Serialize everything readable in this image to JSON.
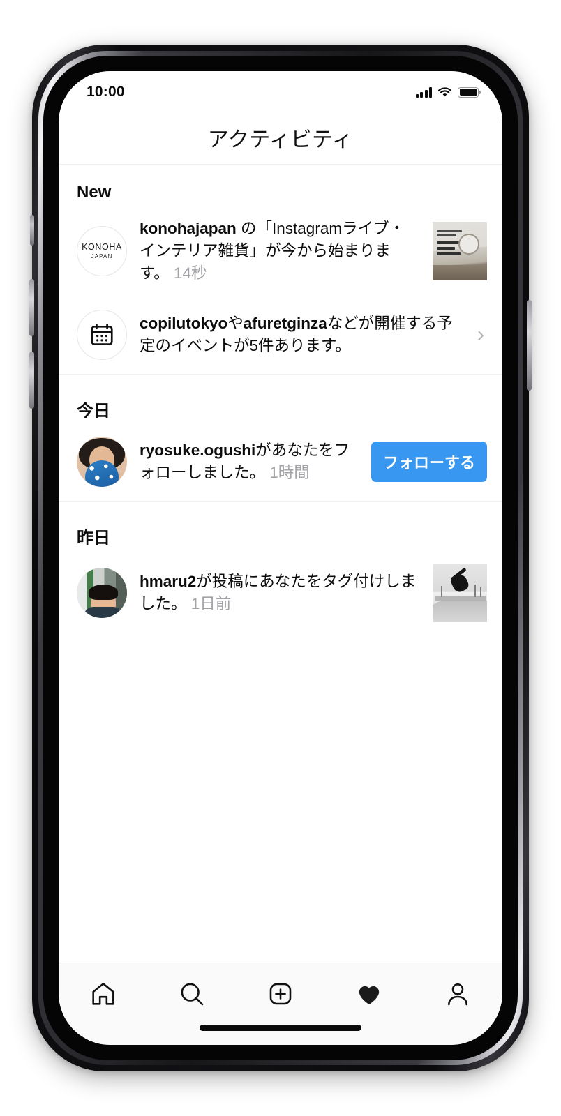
{
  "status_bar": {
    "time": "10:00",
    "signal_icon": "cellular-bars-icon",
    "wifi_icon": "wifi-icon",
    "battery_icon": "battery-full-icon"
  },
  "header": {
    "title": "アクティビティ"
  },
  "sections": [
    {
      "id": "new",
      "title": "New",
      "items": [
        {
          "id": "konohajapan-live",
          "avatar_type": "konoha-logo",
          "avatar_line1": "KONOHA",
          "avatar_line2": "JAPAN",
          "username": "konohajapan",
          "text": " の「Instagramライブ・インテリア雑貨」が今から始まります。",
          "time": "14秒",
          "thumbnail": "interior-post-thumbnail"
        },
        {
          "id": "upcoming-events",
          "avatar_type": "calendar-icon",
          "username": "copilutokyo",
          "username2": "afuretginza",
          "text_mid": "や",
          "text": "などが開催する予定のイベントが5件あります。",
          "chevron": "›"
        }
      ]
    },
    {
      "id": "today",
      "title": "今日",
      "items": [
        {
          "id": "ryosuke-follow",
          "avatar_type": "photo-ogushi",
          "username": "ryosuke.ogushi",
          "text": "があなたをフォローしました。",
          "time": "1時間",
          "action_label": "フォローする",
          "action_color": "#3897f0"
        }
      ]
    },
    {
      "id": "yesterday",
      "title": "昨日",
      "items": [
        {
          "id": "hmaru2-tag",
          "avatar_type": "photo-hmaru",
          "username": "hmaru2",
          "text": "が投稿にあなたをタグ付けしました。",
          "time": "1日前",
          "thumbnail": "skate-post-thumbnail"
        }
      ]
    }
  ],
  "tabbar": {
    "items": [
      {
        "id": "home",
        "icon": "home-icon",
        "active": false
      },
      {
        "id": "search",
        "icon": "search-icon",
        "active": false
      },
      {
        "id": "create",
        "icon": "add-post-icon",
        "active": false
      },
      {
        "id": "activity",
        "icon": "heart-icon",
        "active": true
      },
      {
        "id": "profile",
        "icon": "profile-icon",
        "active": false
      }
    ]
  }
}
